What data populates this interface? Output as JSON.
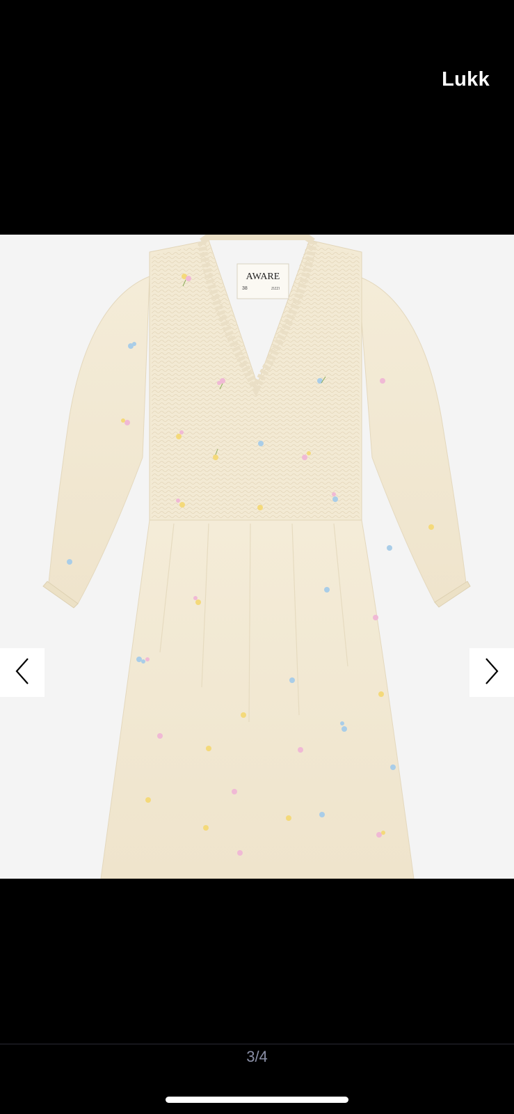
{
  "header": {
    "close_label": "Lukk"
  },
  "image": {
    "brand_label": "AWARE",
    "label_size": "38",
    "label_fine_print": "ZIZZI"
  },
  "navigation": {
    "prev_icon": "chevron-left-icon",
    "next_icon": "chevron-right-icon"
  },
  "footer": {
    "counter": "3/4"
  },
  "colors": {
    "background": "#000000",
    "image_bg": "#f4f4f4",
    "fabric": "#f3ead4",
    "counter_text": "#8a8fa6"
  }
}
